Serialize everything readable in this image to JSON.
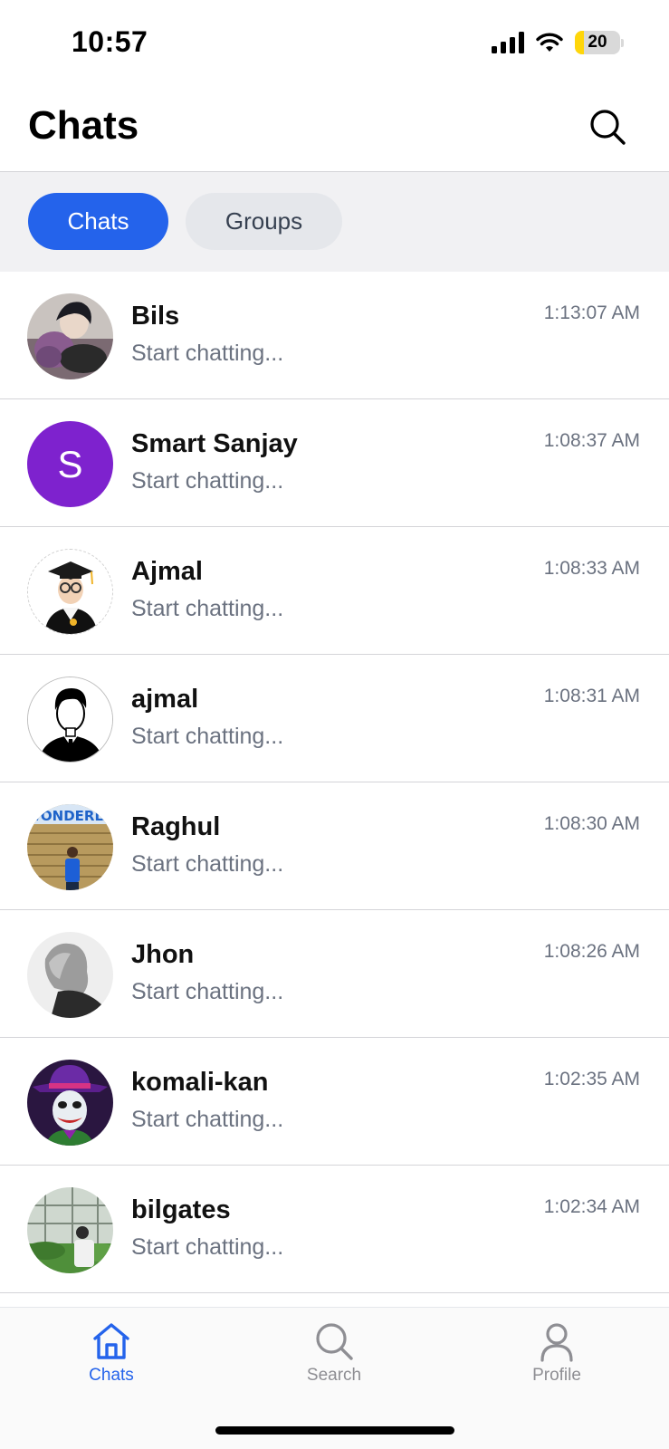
{
  "status_bar": {
    "time": "10:57",
    "battery_level": "20",
    "battery_fraction": 0.2
  },
  "header": {
    "title": "Chats",
    "search_icon": "search-icon"
  },
  "tabs": [
    {
      "label": "Chats",
      "active": true
    },
    {
      "label": "Groups",
      "active": false
    }
  ],
  "chats": [
    {
      "name": "Bils",
      "preview": "Start chatting...",
      "time": "1:13:07 AM",
      "avatar": "photo"
    },
    {
      "name": "Smart Sanjay",
      "preview": "Start chatting...",
      "time": "1:08:37 AM",
      "avatar": "initial",
      "initial": "S",
      "avatar_color": "#7e22ce"
    },
    {
      "name": "Ajmal",
      "preview": "Start chatting...",
      "time": "1:08:33 AM",
      "avatar": "graduate-illustration"
    },
    {
      "name": "ajmal",
      "preview": "Start chatting...",
      "time": "1:08:31 AM",
      "avatar": "silhouette-illustration"
    },
    {
      "name": "Raghul",
      "preview": "Start chatting...",
      "time": "1:08:30 AM",
      "avatar": "photo",
      "avatar_text": "WONDERLA"
    },
    {
      "name": "Jhon",
      "preview": "Start chatting...",
      "time": "1:08:26 AM",
      "avatar": "photo"
    },
    {
      "name": "komali-kan",
      "preview": "Start chatting...",
      "time": "1:02:35 AM",
      "avatar": "photo"
    },
    {
      "name": "bilgates",
      "preview": "Start chatting...",
      "time": "1:02:34 AM",
      "avatar": "photo"
    }
  ],
  "bottom_nav": [
    {
      "label": "Chats",
      "icon": "home-icon",
      "active": true
    },
    {
      "label": "Search",
      "icon": "search-icon",
      "active": false
    },
    {
      "label": "Profile",
      "icon": "user-icon",
      "active": false
    }
  ],
  "colors": {
    "accent": "#2463eb",
    "muted_text": "#6b7280",
    "tab_bar_bg": "#f1f1f3"
  }
}
